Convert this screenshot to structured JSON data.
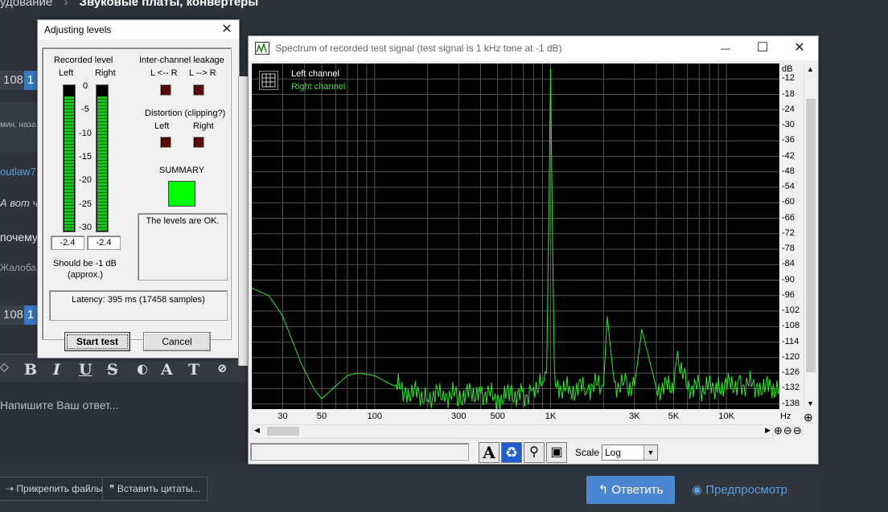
{
  "forum": {
    "breadcrumb_prefix": "удование",
    "breadcrumb_sep": "›",
    "breadcrumb_current": "Звуковые платы, конвертеры",
    "pill_count_1": "108",
    "pill_count_2": "108",
    "pill_page": "1",
    "time_text": "мин. наза",
    "user_name": "outlaw7",
    "quote_text": "А вот ч",
    "question_text": "почему",
    "report_text": "Жалоба",
    "reply_placeholder": "Напишите Ваш ответ...",
    "attach_label": "Прикрепить файлы",
    "insert_quotes_label": "Вставить цитаты...",
    "reply_button": "Ответить",
    "preview_button": "Предпросмотр",
    "formatting": {
      "bold": "B",
      "italic": "I",
      "underline": "U",
      "strike": "S",
      "font": "A",
      "size": "T"
    }
  },
  "levels_dialog": {
    "title": "Adjusting levels",
    "recorded_level_label": "Recorded level",
    "left_label": "Left",
    "right_label": "Right",
    "scale": [
      "0",
      "-5",
      "-10",
      "-15",
      "-20",
      "-25",
      "-30"
    ],
    "left_value": "-2.4",
    "right_value": "-2.4",
    "left_level_fraction": 0.92,
    "right_level_fraction": 0.92,
    "should_be": "Should be  -1 dB",
    "approx": "(approx.)",
    "leakage_label": "Inter-channel leakage",
    "leak_l_from_r": "L <-- R",
    "leak_l_to_r": "L --> R",
    "distortion_label": "Distortion (clipping?)",
    "dist_left": "Left",
    "dist_right": "Right",
    "summary_label": "SUMMARY",
    "summary_color": "#00ff00",
    "summary_text": "The levels are OK.",
    "latency_text": "Latency: 395 ms (17458 samples)",
    "start_button": "Start test",
    "cancel_button": "Cancel",
    "close_glyph": "✕"
  },
  "spectrum_window": {
    "title": "Spectrum of recorded test signal (test signal is 1 kHz tone at -1 dB)",
    "minimize_glyph": "—",
    "maximize_glyph": "☐",
    "close_glyph": "✕",
    "legend_left": "Left channel",
    "legend_right": "Right channel",
    "y_unit": "dB",
    "x_unit": "Hz",
    "scale_label": "Scale",
    "scale_value": "Log"
  },
  "chart_data": {
    "type": "line",
    "title": "Spectrum of recorded test signal (test signal is 1 kHz tone at -1 dB)",
    "xlabel": "Hz",
    "ylabel": "dB",
    "x_scale": "log",
    "xlim": [
      20,
      20000
    ],
    "ylim": [
      -140,
      -6
    ],
    "grid": true,
    "background": "#000000",
    "x_ticks": [
      {
        "v": 30,
        "t": "30"
      },
      {
        "v": 50,
        "t": "50"
      },
      {
        "v": 100,
        "t": "100"
      },
      {
        "v": 300,
        "t": "300"
      },
      {
        "v": 500,
        "t": "500"
      },
      {
        "v": 1000,
        "t": "1K"
      },
      {
        "v": 3000,
        "t": "3K"
      },
      {
        "v": 5000,
        "t": "5K"
      },
      {
        "v": 10000,
        "t": "10K"
      }
    ],
    "y_ticks": [
      "-12",
      "-18",
      "-24",
      "-30",
      "-36",
      "-42",
      "-48",
      "-54",
      "-60",
      "-66",
      "-72",
      "-78",
      "-84",
      "-90",
      "-96",
      "-102",
      "-108",
      "-114",
      "-120",
      "-126",
      "-132",
      "-138"
    ],
    "series": [
      {
        "name": "Left channel",
        "color": "#ffffff",
        "x": [],
        "y": []
      },
      {
        "name": "Right channel",
        "color": "#22ee22",
        "x": [
          20,
          25,
          30,
          38,
          45,
          50,
          60,
          70,
          80,
          100,
          120,
          150,
          200,
          250,
          300,
          400,
          500,
          600,
          700,
          800,
          900,
          950,
          980,
          1000,
          1020,
          1050,
          1100,
          1300,
          1600,
          2000,
          2100,
          2300,
          2700,
          3000,
          3300,
          4000,
          5000,
          5200,
          6000,
          7000,
          9000,
          12000,
          15000,
          20000
        ],
        "y": [
          -93,
          -96,
          -104,
          -122,
          -132,
          -136,
          -131,
          -127,
          -126,
          -127,
          -130,
          -133,
          -135,
          -134,
          -135,
          -133,
          -136,
          -134,
          -135,
          -132,
          -128,
          -126,
          -60,
          -8,
          -60,
          -126,
          -131,
          -133,
          -131,
          -131,
          -104,
          -130,
          -131,
          -131,
          -109,
          -132,
          -131,
          -118,
          -131,
          -132,
          -131,
          -130,
          -131,
          -132
        ]
      }
    ]
  }
}
